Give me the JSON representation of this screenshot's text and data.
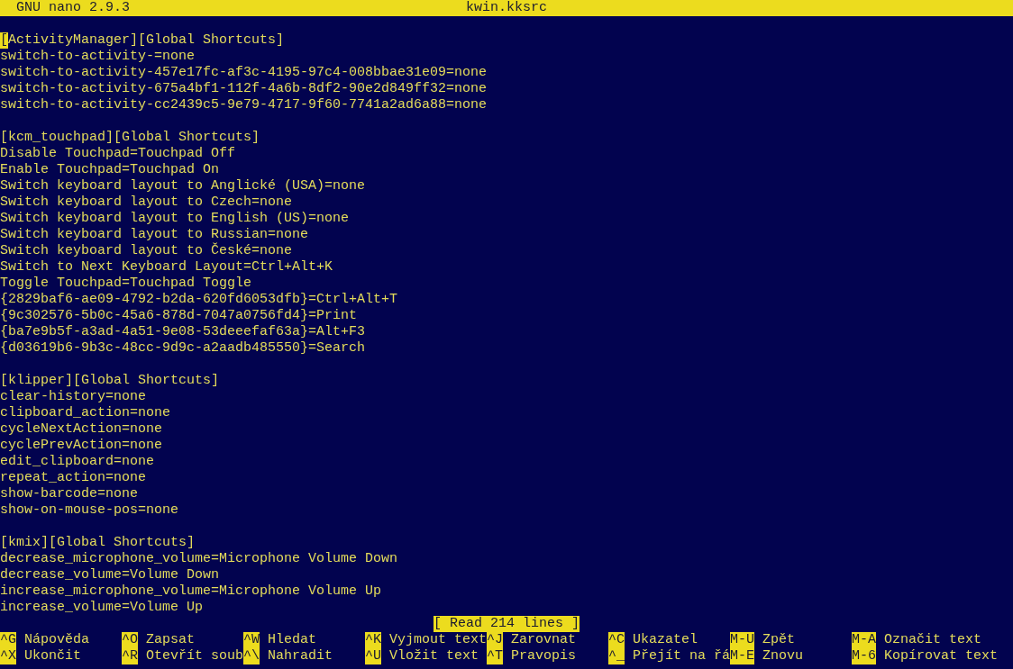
{
  "title_bar": {
    "app": "GNU nano 2.9.3",
    "file": "kwin.kksrc"
  },
  "lines": [
    {
      "kind": "text",
      "cursor": "[",
      "text": "ActivityManager][Global Shortcuts]"
    },
    {
      "kind": "text",
      "text": "switch-to-activity-=none"
    },
    {
      "kind": "text",
      "text": "switch-to-activity-457e17fc-af3c-4195-97c4-008bbae31e09=none"
    },
    {
      "kind": "text",
      "text": "switch-to-activity-675a4bf1-112f-4a6b-8df2-90e2d849ff32=none"
    },
    {
      "kind": "text",
      "text": "switch-to-activity-cc2439c5-9e79-4717-9f60-7741a2ad6a88=none"
    },
    {
      "kind": "blank"
    },
    {
      "kind": "text",
      "text": "[kcm_touchpad][Global Shortcuts]"
    },
    {
      "kind": "text",
      "text": "Disable Touchpad=Touchpad Off"
    },
    {
      "kind": "text",
      "text": "Enable Touchpad=Touchpad On"
    },
    {
      "kind": "text",
      "text": "Switch keyboard layout to Anglické (USA)=none"
    },
    {
      "kind": "text",
      "text": "Switch keyboard layout to Czech=none"
    },
    {
      "kind": "text",
      "text": "Switch keyboard layout to English (US)=none"
    },
    {
      "kind": "text",
      "text": "Switch keyboard layout to Russian=none"
    },
    {
      "kind": "text",
      "text": "Switch keyboard layout to České=none"
    },
    {
      "kind": "text",
      "text": "Switch to Next Keyboard Layout=Ctrl+Alt+K"
    },
    {
      "kind": "text",
      "text": "Toggle Touchpad=Touchpad Toggle"
    },
    {
      "kind": "text",
      "text": "{2829baf6-ae09-4792-b2da-620fd6053dfb}=Ctrl+Alt+T"
    },
    {
      "kind": "text",
      "text": "{9c302576-5b0c-45a6-878d-7047a0756fd4}=Print"
    },
    {
      "kind": "text",
      "text": "{ba7e9b5f-a3ad-4a51-9e08-53deeefaf63a}=Alt+F3"
    },
    {
      "kind": "text",
      "text": "{d03619b6-9b3c-48cc-9d9c-a2aadb485550}=Search"
    },
    {
      "kind": "blank"
    },
    {
      "kind": "text",
      "text": "[klipper][Global Shortcuts]"
    },
    {
      "kind": "text",
      "text": "clear-history=none"
    },
    {
      "kind": "text",
      "text": "clipboard_action=none"
    },
    {
      "kind": "text",
      "text": "cycleNextAction=none"
    },
    {
      "kind": "text",
      "text": "cyclePrevAction=none"
    },
    {
      "kind": "text",
      "text": "edit_clipboard=none"
    },
    {
      "kind": "text",
      "text": "repeat_action=none"
    },
    {
      "kind": "text",
      "text": "show-barcode=none"
    },
    {
      "kind": "text",
      "text": "show-on-mouse-pos=none"
    },
    {
      "kind": "blank"
    },
    {
      "kind": "text",
      "text": "[kmix][Global Shortcuts]"
    },
    {
      "kind": "text",
      "text": "decrease_microphone_volume=Microphone Volume Down"
    },
    {
      "kind": "text",
      "text": "decrease_volume=Volume Down"
    },
    {
      "kind": "text",
      "text": "increase_microphone_volume=Microphone Volume Up"
    },
    {
      "kind": "text",
      "text": "increase_volume=Volume Up"
    }
  ],
  "status": "[ Read 214 lines ]",
  "shortcut_rows": [
    [
      {
        "key": "^G",
        "label": "Nápověda"
      },
      {
        "key": "^O",
        "label": "Zapsat"
      },
      {
        "key": "^W",
        "label": "Hledat"
      },
      {
        "key": "^K",
        "label": "Vyjmout text"
      },
      {
        "key": "^J",
        "label": "Zarovnat"
      },
      {
        "key": "^C",
        "label": "Ukazatel"
      },
      {
        "key": "M-U",
        "label": "Zpět"
      },
      {
        "key": "M-A",
        "label": "Označit text"
      }
    ],
    [
      {
        "key": "^X",
        "label": "Ukončit"
      },
      {
        "key": "^R",
        "label": "Otevřít soub"
      },
      {
        "key": "^\\",
        "label": "Nahradit"
      },
      {
        "key": "^U",
        "label": "Vložit text"
      },
      {
        "key": "^T",
        "label": "Pravopis"
      },
      {
        "key": "^_",
        "label": "Přejít na řá"
      },
      {
        "key": "M-E",
        "label": "Znovu"
      },
      {
        "key": "M-6",
        "label": "Kopírovat text"
      }
    ]
  ]
}
